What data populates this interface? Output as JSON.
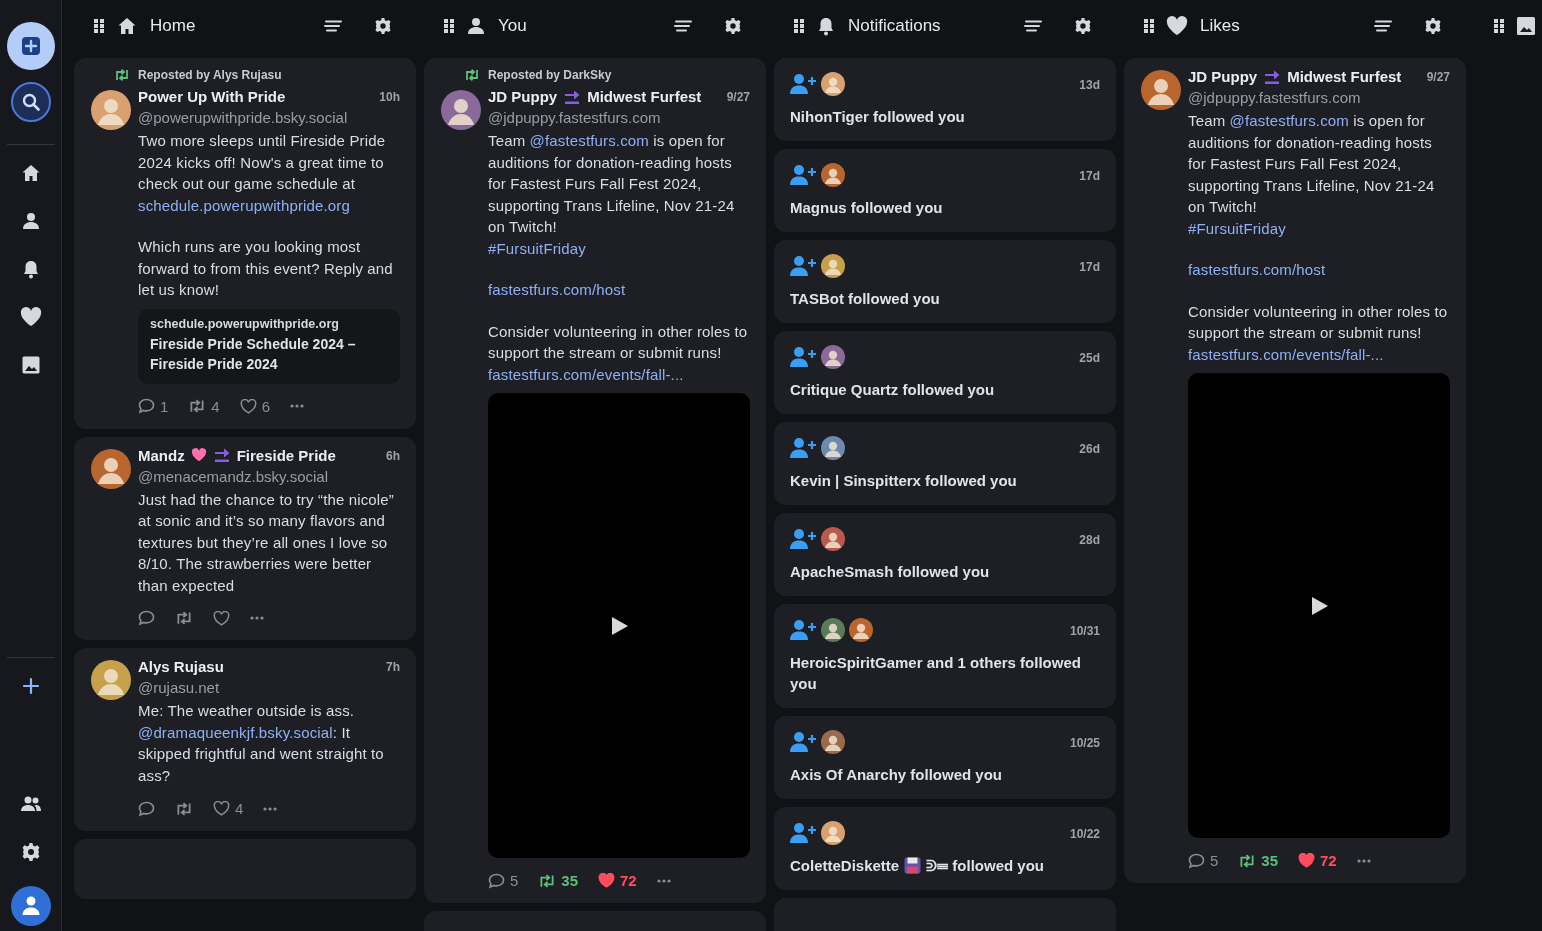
{
  "sidebar": {
    "top": [
      {
        "kind": "compose"
      },
      {
        "kind": "search"
      }
    ],
    "nav": [
      {
        "kind": "home"
      },
      {
        "kind": "profile"
      },
      {
        "kind": "notifications"
      },
      {
        "kind": "likes"
      },
      {
        "kind": "media"
      }
    ],
    "bottom": [
      {
        "kind": "add"
      },
      {
        "kind": "people"
      },
      {
        "kind": "settings"
      },
      {
        "kind": "account"
      }
    ]
  },
  "columns": [
    {
      "kind": "home",
      "title": "Home",
      "settings": true,
      "more_below": true,
      "posts": [
        {
          "repost_by": "Reposted by Alys Rujasu",
          "name_parts": [
            {
              "kind": "text",
              "text": "Power Up With Pride"
            }
          ],
          "time": "10h",
          "handle": "@powerupwithpride.bsky.social",
          "paragraphs": [
            [
              {
                "kind": "text",
                "text": "Two more sleeps until Fireside Pride 2024 kicks off! Now's a great time to check out our game schedule at "
              },
              {
                "kind": "link",
                "text": "schedule.powerupwithpride.org"
              }
            ],
            [
              {
                "kind": "text",
                "text": "Which runs are you looking most forward to from this event? Reply and let us know!"
              }
            ]
          ],
          "link_card": {
            "domain": "schedule.powerupwithpride.org",
            "title": "Fireside Pride Schedule 2024 – Fireside Pride 2024"
          },
          "actions": {
            "replies": "1",
            "reposts": "4",
            "likes": "6",
            "reposted": false,
            "liked": false
          }
        },
        {
          "name_parts": [
            {
              "kind": "text",
              "text": "Mandz"
            },
            {
              "kind": "heart"
            },
            {
              "kind": "soon"
            },
            {
              "kind": "text",
              "text": "Fireside Pride"
            }
          ],
          "time": "6h",
          "handle": "@menacemandz.bsky.social",
          "paragraphs": [
            [
              {
                "kind": "text",
                "text": "Just had the chance to try “the nicole” at sonic and it’s so many flavors and textures but they’re all ones I love so 8/10. The strawberries were better than expected"
              }
            ]
          ],
          "actions": {
            "reposted": false,
            "liked": false
          }
        },
        {
          "name_parts": [
            {
              "kind": "text",
              "text": "Alys Rujasu"
            }
          ],
          "time": "7h",
          "handle": "@rujasu.net",
          "paragraphs": [
            [
              {
                "kind": "text",
                "text": "Me: The weather outside is ass.\n"
              },
              {
                "kind": "link",
                "text": "@dramaqueenkjf.bsky.social"
              },
              {
                "kind": "text",
                "text": ": It skipped frightful and went straight to ass?"
              }
            ]
          ],
          "actions": {
            "likes": "4",
            "reposted": false,
            "liked": false
          }
        }
      ]
    },
    {
      "kind": "profile",
      "title": "You",
      "settings": true,
      "more_below": true,
      "posts": [
        {
          "repost_by": "Reposted by DarkSky",
          "name_parts": [
            {
              "kind": "text",
              "text": "JD Puppy"
            },
            {
              "kind": "soon"
            },
            {
              "kind": "text",
              "text": "Midwest Furfest"
            }
          ],
          "time": "9/27",
          "handle": "@jdpuppy.fastestfurs.com",
          "paragraphs": [
            [
              {
                "kind": "text",
                "text": "Team "
              },
              {
                "kind": "link",
                "text": "@fastestfurs.com"
              },
              {
                "kind": "text",
                "text": " is open for auditions for donation-reading hosts for Fastest Furs Fall Fest 2024, supporting Trans Lifeline, Nov 21-24 on Twitch!\n"
              },
              {
                "kind": "link",
                "text": "#FursuitFriday"
              }
            ],
            [
              {
                "kind": "link",
                "text": "fastestfurs.com/host"
              }
            ],
            [
              {
                "kind": "text",
                "text": "Consider volunteering in other roles to support the stream or submit runs!  "
              },
              {
                "kind": "link",
                "text": "fastestfurs.com/events/fall-..."
              }
            ]
          ],
          "video": {
            "kind": "video"
          },
          "actions": {
            "replies": "5",
            "reposts": "35",
            "likes": "72",
            "reposted": true,
            "liked": true
          }
        }
      ]
    },
    {
      "kind": "notifications",
      "title": "Notifications",
      "settings": true,
      "more_below": true,
      "notifications": [
        {
          "time": "13d",
          "avatars": [
            {
              "kind": "picture"
            }
          ],
          "parts": [
            {
              "kind": "text",
              "text": "NihonTiger followed you"
            }
          ]
        },
        {
          "time": "17d",
          "avatars": [
            {
              "kind": "picture"
            }
          ],
          "parts": [
            {
              "kind": "text",
              "text": "Magnus followed you"
            }
          ]
        },
        {
          "time": "17d",
          "avatars": [
            {
              "kind": "picture"
            }
          ],
          "parts": [
            {
              "kind": "text",
              "text": "TASBot followed you"
            }
          ]
        },
        {
          "time": "25d",
          "avatars": [
            {
              "kind": "picture"
            }
          ],
          "parts": [
            {
              "kind": "text",
              "text": "Critique Quartz followed you"
            }
          ]
        },
        {
          "time": "26d",
          "avatars": [
            {
              "kind": "picture"
            }
          ],
          "parts": [
            {
              "kind": "text",
              "text": "Kevin | Sinspitterx followed you"
            }
          ]
        },
        {
          "time": "28d",
          "avatars": [
            {
              "kind": "picture"
            }
          ],
          "parts": [
            {
              "kind": "text",
              "text": "ApacheSmash followed you"
            }
          ]
        },
        {
          "time": "10/31",
          "avatars": [
            {
              "kind": "picture"
            },
            {
              "kind": "picture"
            }
          ],
          "parts": [
            {
              "kind": "text",
              "text": "HeroicSpiritGamer and 1 others followed you"
            }
          ]
        },
        {
          "time": "10/25",
          "avatars": [
            {
              "kind": "picture"
            }
          ],
          "parts": [
            {
              "kind": "text",
              "text": "Axis Of Anarchy followed you"
            }
          ]
        },
        {
          "time": "10/22",
          "avatars": [
            {
              "kind": "picture"
            }
          ],
          "parts": [
            {
              "kind": "text",
              "text": "ColetteDiskette"
            },
            {
              "kind": "floppy"
            },
            {
              "kind": "text",
              "text": "ᕲ☰ followed you"
            }
          ]
        }
      ]
    },
    {
      "kind": "likes",
      "title": "Likes",
      "settings": true,
      "more_below": false,
      "posts": [
        {
          "name_parts": [
            {
              "kind": "text",
              "text": "JD Puppy"
            },
            {
              "kind": "soon"
            },
            {
              "kind": "text",
              "text": "Midwest Furfest"
            }
          ],
          "time": "9/27",
          "handle": "@jdpuppy.fastestfurs.com",
          "paragraphs": [
            [
              {
                "kind": "text",
                "text": "Team "
              },
              {
                "kind": "link",
                "text": "@fastestfurs.com"
              },
              {
                "kind": "text",
                "text": " is open for auditions for donation-reading hosts for Fastest Furs Fall Fest 2024, supporting Trans Lifeline, Nov 21-24 on Twitch!\n"
              },
              {
                "kind": "link",
                "text": "#FursuitFriday"
              }
            ],
            [
              {
                "kind": "link",
                "text": "fastestfurs.com/host"
              }
            ],
            [
              {
                "kind": "text",
                "text": "Consider volunteering in other roles to support the stream or submit runs!  "
              },
              {
                "kind": "link",
                "text": "fastestfurs.com/events/fall-..."
              }
            ]
          ],
          "video": {
            "kind": "video"
          },
          "actions": {
            "replies": "5",
            "reposts": "35",
            "likes": "72",
            "reposted": true,
            "liked": true
          }
        }
      ]
    },
    {
      "kind": "media",
      "settings": false,
      "more_below": false
    }
  ]
}
